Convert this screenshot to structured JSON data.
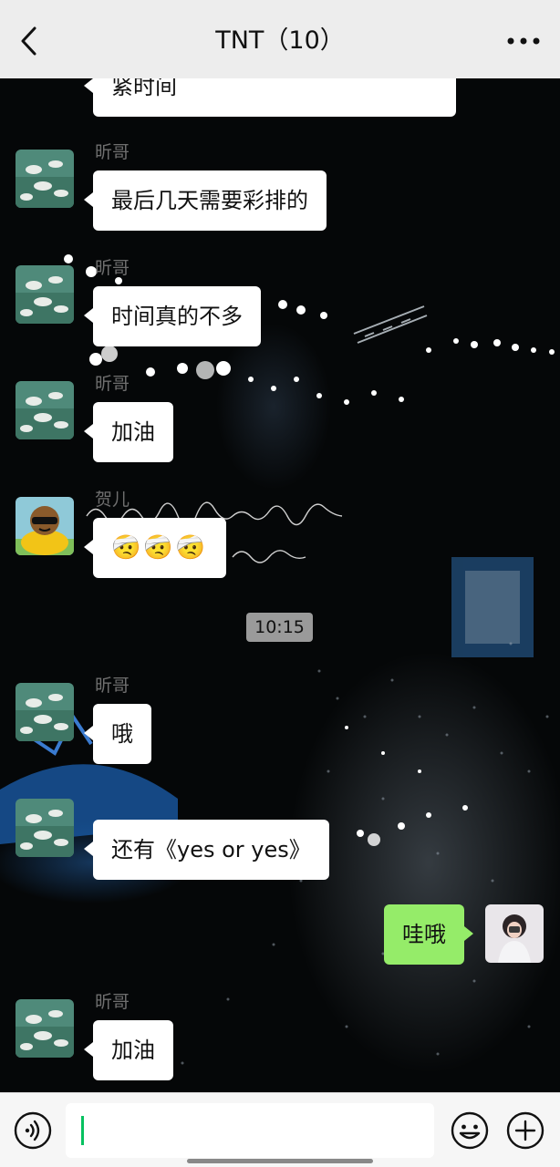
{
  "header": {
    "title": "TNT（10）",
    "back_icon": "chevron-left-icon",
    "more_icon": "more-dots-icon"
  },
  "messages": [
    {
      "side": "left",
      "sender": "",
      "text": "紧时间",
      "avatar": "ducks-pond"
    },
    {
      "side": "left",
      "sender": "昕哥",
      "text": "最后几天需要彩排的",
      "avatar": "ducks-pond"
    },
    {
      "side": "left",
      "sender": "昕哥",
      "text": "时间真的不多",
      "avatar": "ducks-pond"
    },
    {
      "side": "left",
      "sender": "昕哥",
      "text": "加油",
      "avatar": "ducks-pond"
    },
    {
      "side": "left",
      "sender": "贺儿",
      "text": "🤕🤕🤕",
      "avatar": "cartoon-sunglasses"
    },
    {
      "side": "left",
      "sender": "昕哥",
      "text": "哦",
      "avatar": "ducks-pond"
    },
    {
      "side": "left",
      "sender": "",
      "text": "还有《yes or yes》",
      "avatar": "ducks-pond"
    },
    {
      "side": "right",
      "sender": "",
      "text": "哇哦",
      "avatar": "girl-photo"
    },
    {
      "side": "left",
      "sender": "昕哥",
      "text": "加油",
      "avatar": "ducks-pond"
    }
  ],
  "timestamp": "10:15",
  "background": {
    "handwriting": "dream you dream alone is only a dream dream togeth"
  },
  "input_bar": {
    "value": "",
    "voice_icon": "voice-icon",
    "emoji_icon": "emoji-icon",
    "plus_icon": "plus-icon"
  },
  "colors": {
    "header_bg": "#ededed",
    "chat_bg": "#050708",
    "bubble_left": "#ffffff",
    "bubble_right": "#95ec69",
    "caret": "#07c160",
    "time_pill": "#9a9a9a"
  }
}
